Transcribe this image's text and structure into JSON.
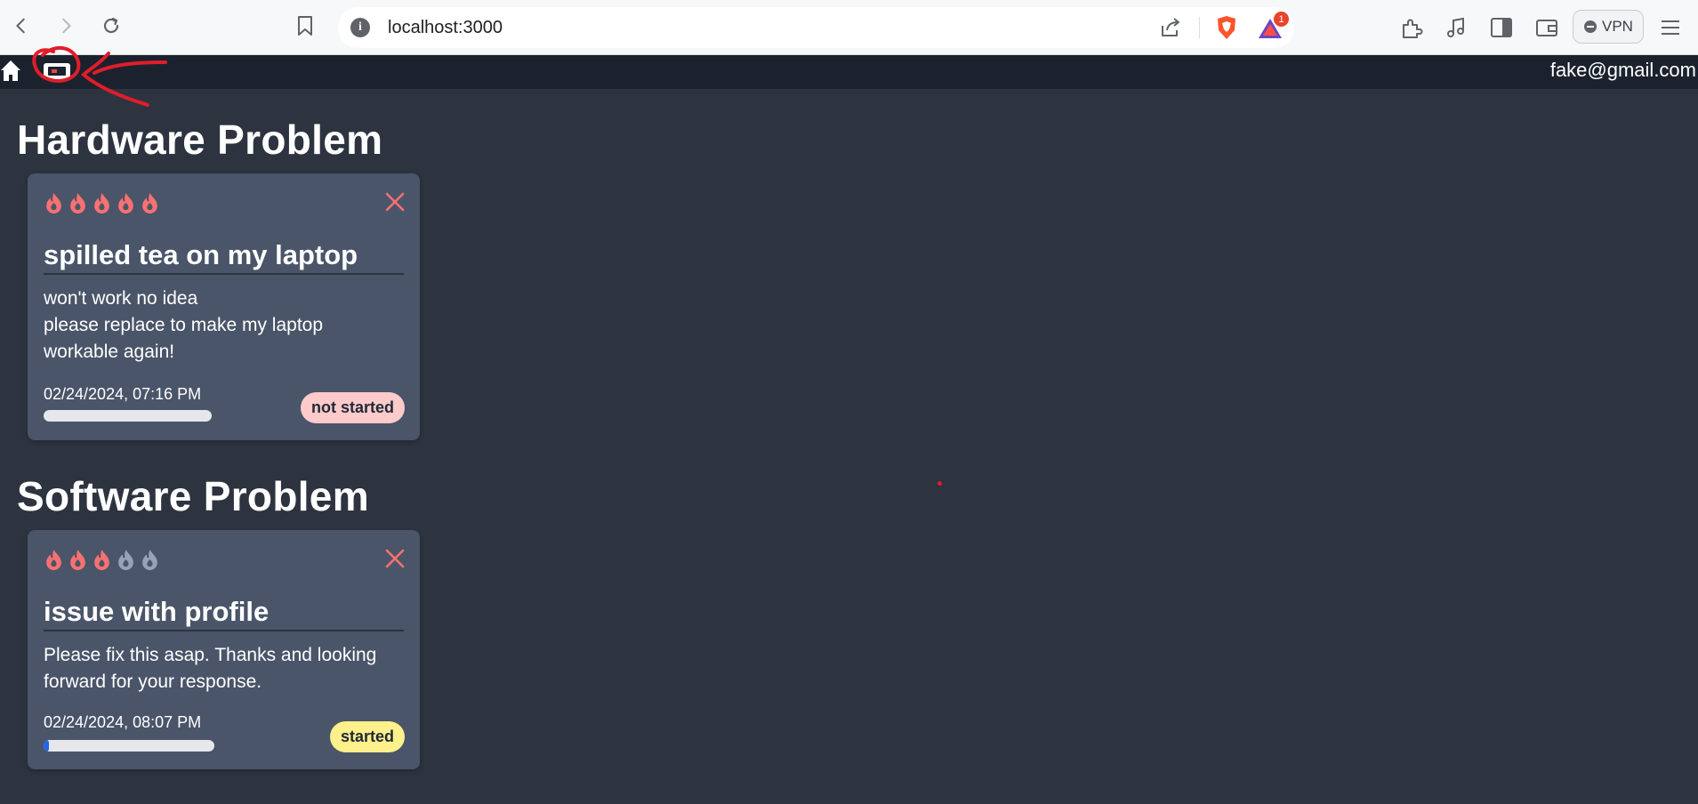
{
  "browser": {
    "url": "localhost:3000",
    "vpn_label": "VPN",
    "rewards_count": "1"
  },
  "nav": {
    "user_email": "fake@gmail.com"
  },
  "sections": [
    {
      "title": "Hardware Problem",
      "card": {
        "priority": 5,
        "max_priority": 5,
        "title": "spilled tea on my laptop",
        "description_lines": [
          "won't work no idea",
          "please replace to make my laptop",
          "workable again!"
        ],
        "date": "02/24/2024, 07:16 PM",
        "progress": 0,
        "status": "not started"
      }
    },
    {
      "title": "Software Problem",
      "card": {
        "priority": 3,
        "max_priority": 5,
        "title": "issue with profile",
        "description_lines": [
          "Please fix this asap. Thanks and looking",
          "forward for your response."
        ],
        "date": "02/24/2024, 08:07 PM",
        "progress": 0.03,
        "status": "started"
      }
    }
  ],
  "colors": {
    "flame_active": "#f87171",
    "flame_inactive": "#94a3b8",
    "status_not_started": "#fecaca",
    "status_started": "#fef08a",
    "annotation": "#e11d2a"
  }
}
